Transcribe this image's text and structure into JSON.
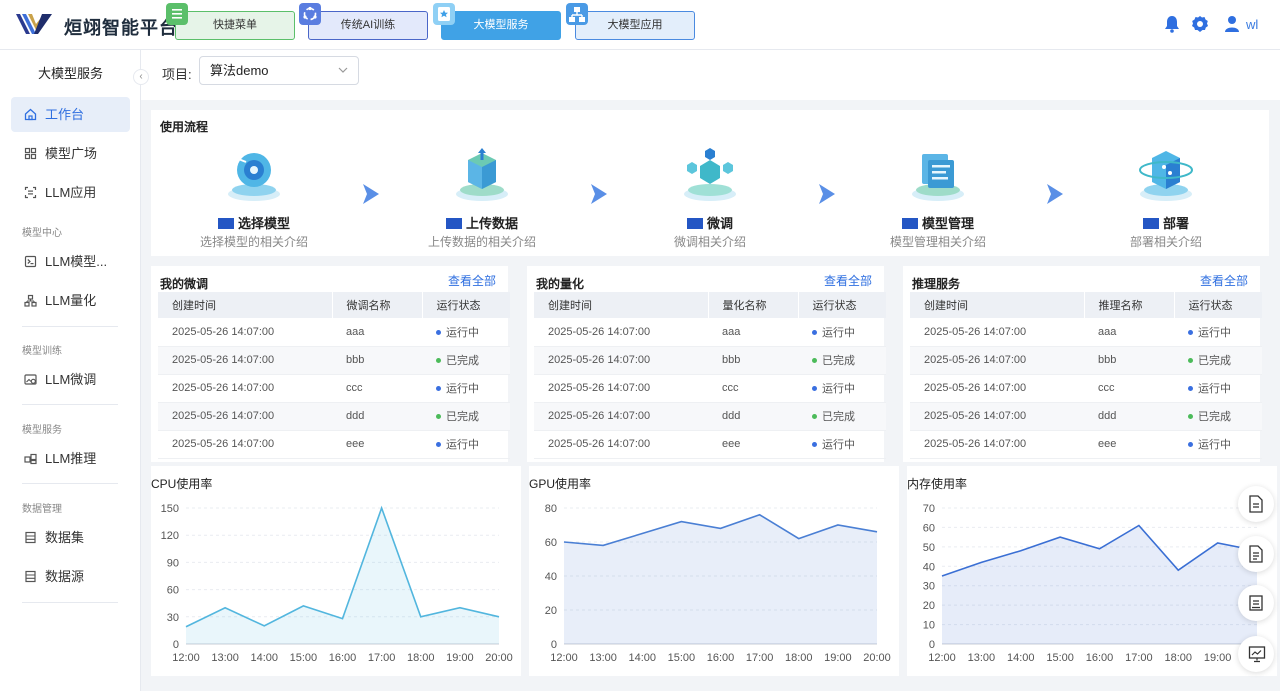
{
  "header": {
    "brand": "烜翊智能平台",
    "tabs": [
      {
        "label": "快捷菜单",
        "icon": "menu-icon",
        "color": "#5bbf6a"
      },
      {
        "label": "传统AI训练",
        "icon": "cycle-icon",
        "color": "#5a7de0"
      },
      {
        "label": "大模型服务",
        "icon": "star-icon",
        "color": "#3fa0e8"
      },
      {
        "label": "大模型应用",
        "icon": "hierarchy-icon",
        "color": "#4a9ae5"
      }
    ],
    "user": "wl"
  },
  "sidebar": {
    "title": "大模型服务",
    "items": [
      {
        "label": "工作台",
        "icon": "home-icon",
        "active": true
      },
      {
        "label": "模型广场",
        "icon": "grid-icon"
      },
      {
        "label": "LLM应用",
        "icon": "scan-icon"
      },
      {
        "group": "模型中心"
      },
      {
        "label": "LLM模型...",
        "icon": "terminal-icon"
      },
      {
        "label": "LLM量化",
        "icon": "cluster-icon"
      },
      {
        "group": "模型训练"
      },
      {
        "label": "LLM微调",
        "icon": "image-tune-icon"
      },
      {
        "group": "模型服务"
      },
      {
        "label": "LLM推理",
        "icon": "inference-icon"
      },
      {
        "group": "数据管理"
      },
      {
        "label": "数据集",
        "icon": "dataset-icon"
      },
      {
        "label": "数据源",
        "icon": "datasource-icon"
      }
    ]
  },
  "project": {
    "label": "项目:",
    "value": "算法demo"
  },
  "flow": {
    "title": "使用流程",
    "steps": [
      {
        "name": "选择模型",
        "desc": "选择模型的相关介绍",
        "icon": "select-model-icon"
      },
      {
        "name": "上传数据",
        "desc": "上传数据的相关介绍",
        "icon": "upload-data-icon"
      },
      {
        "name": "微调",
        "desc": "微调相关介绍",
        "icon": "finetune-icon"
      },
      {
        "name": "模型管理",
        "desc": "模型管理相关介绍",
        "icon": "model-manage-icon"
      },
      {
        "name": "部署",
        "desc": "部署相关介绍",
        "icon": "deploy-icon"
      }
    ]
  },
  "panels": [
    {
      "title": "我的微调",
      "more": "查看全部",
      "headers": [
        "创建时间",
        "微调名称",
        "运行状态"
      ],
      "rows": [
        [
          "2025-05-26 14:07:00",
          "aaa",
          "运行中"
        ],
        [
          "2025-05-26 14:07:00",
          "bbb",
          "已完成"
        ],
        [
          "2025-05-26 14:07:00",
          "ccc",
          "运行中"
        ],
        [
          "2025-05-26 14:07:00",
          "ddd",
          "已完成"
        ],
        [
          "2025-05-26 14:07:00",
          "eee",
          "运行中"
        ]
      ]
    },
    {
      "title": "我的量化",
      "more": "查看全部",
      "headers": [
        "创建时间",
        "量化名称",
        "运行状态"
      ],
      "rows": [
        [
          "2025-05-26 14:07:00",
          "aaa",
          "运行中"
        ],
        [
          "2025-05-26 14:07:00",
          "bbb",
          "已完成"
        ],
        [
          "2025-05-26 14:07:00",
          "ccc",
          "运行中"
        ],
        [
          "2025-05-26 14:07:00",
          "ddd",
          "已完成"
        ],
        [
          "2025-05-26 14:07:00",
          "eee",
          "运行中"
        ]
      ]
    },
    {
      "title": "推理服务",
      "more": "查看全部",
      "headers": [
        "创建时间",
        "推理名称",
        "运行状态"
      ],
      "rows": [
        [
          "2025-05-26 14:07:00",
          "aaa",
          "运行中"
        ],
        [
          "2025-05-26 14:07:00",
          "bbb",
          "已完成"
        ],
        [
          "2025-05-26 14:07:00",
          "ccc",
          "运行中"
        ],
        [
          "2025-05-26 14:07:00",
          "ddd",
          "已完成"
        ],
        [
          "2025-05-26 14:07:00",
          "eee",
          "运行中"
        ]
      ]
    }
  ],
  "status_colors": {
    "运行中": "#3a6fe0",
    "已完成": "#4cbb5a"
  },
  "chart_data": [
    {
      "type": "area",
      "title": "CPU使用率",
      "x": [
        "12:00",
        "13:00",
        "14:00",
        "15:00",
        "16:00",
        "17:00",
        "18:00",
        "19:00",
        "20:00"
      ],
      "values": [
        19,
        40,
        20,
        42,
        28,
        150,
        30,
        40,
        30
      ],
      "ylim": [
        0,
        150
      ],
      "yticks": [
        0,
        30,
        60,
        90,
        120,
        150
      ],
      "color": "#52b6de",
      "grid": true
    },
    {
      "type": "area",
      "title": "GPU使用率",
      "x": [
        "12:00",
        "13:00",
        "14:00",
        "15:00",
        "16:00",
        "17:00",
        "18:00",
        "19:00",
        "20:00"
      ],
      "values": [
        60,
        58,
        65,
        72,
        68,
        76,
        62,
        70,
        66
      ],
      "ylim": [
        0,
        80
      ],
      "yticks": [
        0,
        20,
        40,
        60,
        80
      ],
      "color": "#4a7fd4",
      "grid": true
    },
    {
      "type": "area",
      "title": "内存使用率",
      "x": [
        "12:00",
        "13:00",
        "14:00",
        "15:00",
        "16:00",
        "17:00",
        "18:00",
        "19:00"
      ],
      "values": [
        35,
        42,
        48,
        55,
        49,
        61,
        38,
        52,
        48
      ],
      "ylim": [
        0,
        70
      ],
      "yticks": [
        0,
        10,
        20,
        30,
        40,
        50,
        60,
        70
      ],
      "color": "#3a6fd4",
      "grid": true
    }
  ],
  "fabs": [
    "document-icon",
    "document-lines-icon",
    "ocr-icon",
    "presentation-icon"
  ]
}
